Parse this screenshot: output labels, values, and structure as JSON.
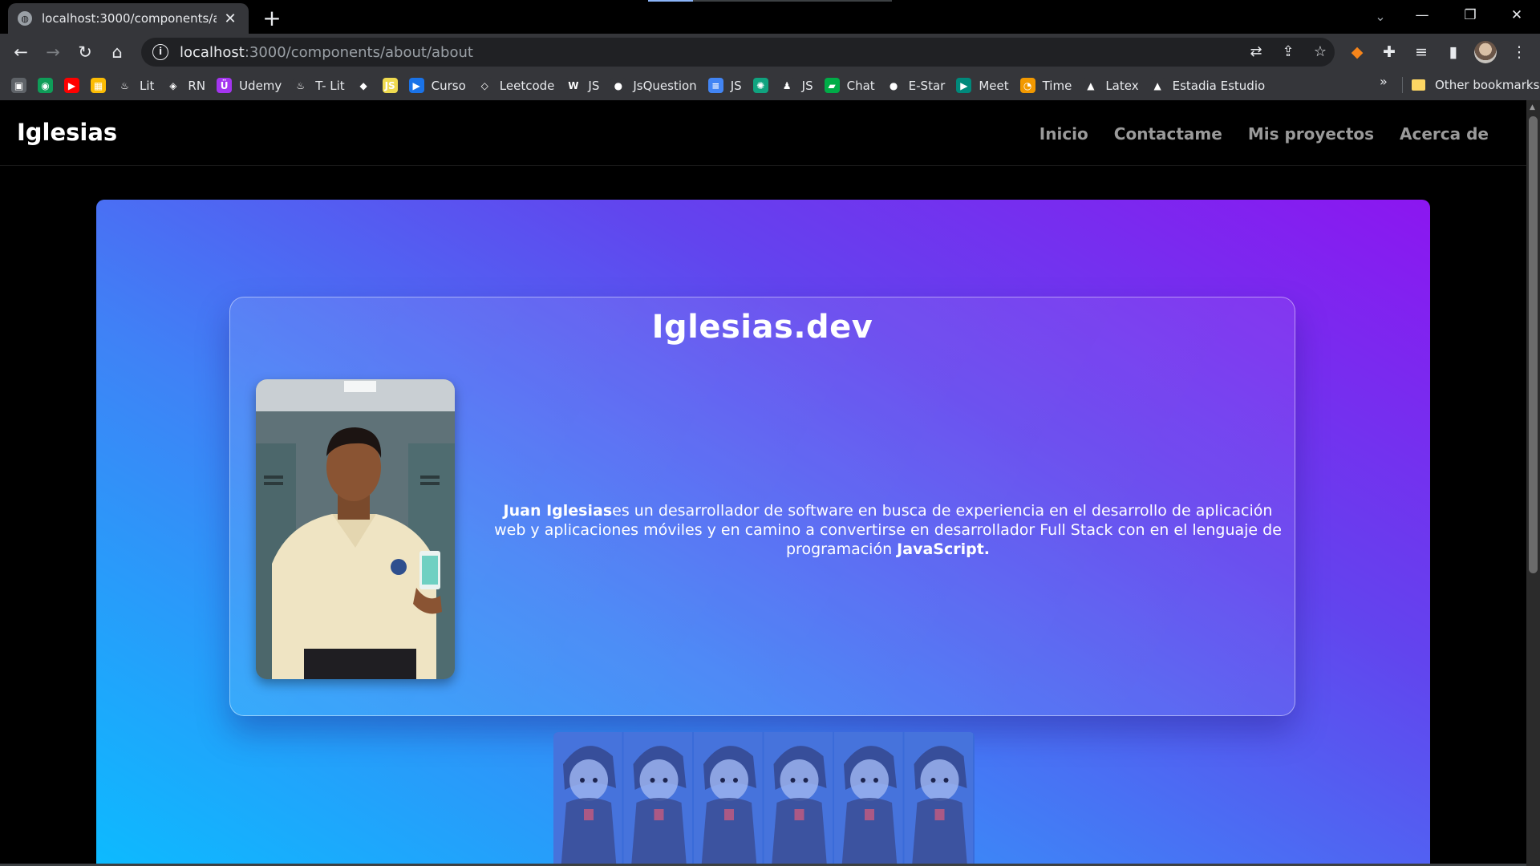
{
  "browser": {
    "tab_title": "localhost:3000/components/abou",
    "url_host": "localhost",
    "url_path": ":3000/components/about/about",
    "bookmarks": [
      {
        "label": "",
        "icon": "save-page-icon",
        "color": "#5f6368"
      },
      {
        "label": "",
        "icon": "chrome-icon",
        "color": "#0f9d58"
      },
      {
        "label": "",
        "icon": "youtube-icon",
        "color": "#ff0000"
      },
      {
        "label": "",
        "icon": "grid-app-icon",
        "color": "#fbbc04"
      },
      {
        "label": "Lit",
        "icon": "flame-icon",
        "color": "#35363a"
      },
      {
        "label": "RN",
        "icon": "diamond-icon",
        "color": "#35363a"
      },
      {
        "label": "Udemy",
        "icon": "udemy-icon",
        "color": "#a435f0"
      },
      {
        "label": "T- Lit",
        "icon": "flame-icon",
        "color": "#35363a"
      },
      {
        "label": "",
        "icon": "diamond-green-icon",
        "color": "#35363a"
      },
      {
        "label": "",
        "icon": "js-icon",
        "color": "#f0db4f"
      },
      {
        "label": "Curso",
        "icon": "play-icon",
        "color": "#1a73e8"
      },
      {
        "label": "Leetcode",
        "icon": "leetcode-icon",
        "color": "#35363a"
      },
      {
        "label": "JS",
        "icon": "w3-icon",
        "color": "#35363a"
      },
      {
        "label": "JsQuestion",
        "icon": "github-icon",
        "color": "#35363a"
      },
      {
        "label": "JS",
        "icon": "docs-icon",
        "color": "#4285f4"
      },
      {
        "label": "",
        "icon": "openai-icon",
        "color": "#10a37f"
      },
      {
        "label": "JS",
        "icon": "figure-icon",
        "color": "#35363a"
      },
      {
        "label": "Chat",
        "icon": "chat-icon",
        "color": "#00ac47"
      },
      {
        "label": "E-Star",
        "icon": "github-icon",
        "color": "#35363a"
      },
      {
        "label": "Meet",
        "icon": "meet-icon",
        "color": "#00897b"
      },
      {
        "label": "Time",
        "icon": "clock-icon",
        "color": "#f29900"
      },
      {
        "label": "Latex",
        "icon": "drive-icon",
        "color": "#35363a"
      },
      {
        "label": "Estadia Estudio",
        "icon": "drive-icon",
        "color": "#35363a"
      }
    ],
    "more_bookmarks": "»",
    "other_bookmarks": "Other bookmarks"
  },
  "site": {
    "brand": "Iglesias",
    "nav": [
      "Inicio",
      "Contactame",
      "Mis proyectos",
      "Acerca de"
    ],
    "card_title": "Iglesias.dev",
    "bio_name": "Juan Iglesias",
    "bio_text": "es un desarrollador de software en busca de experiencia en el desarrollo de aplicación web y aplicaciones móviles y en camino a convertirse en desarrollador Full Stack con en el lenguaje de programación ",
    "bio_lang": "JavaScript.",
    "sprite_count": 6
  }
}
